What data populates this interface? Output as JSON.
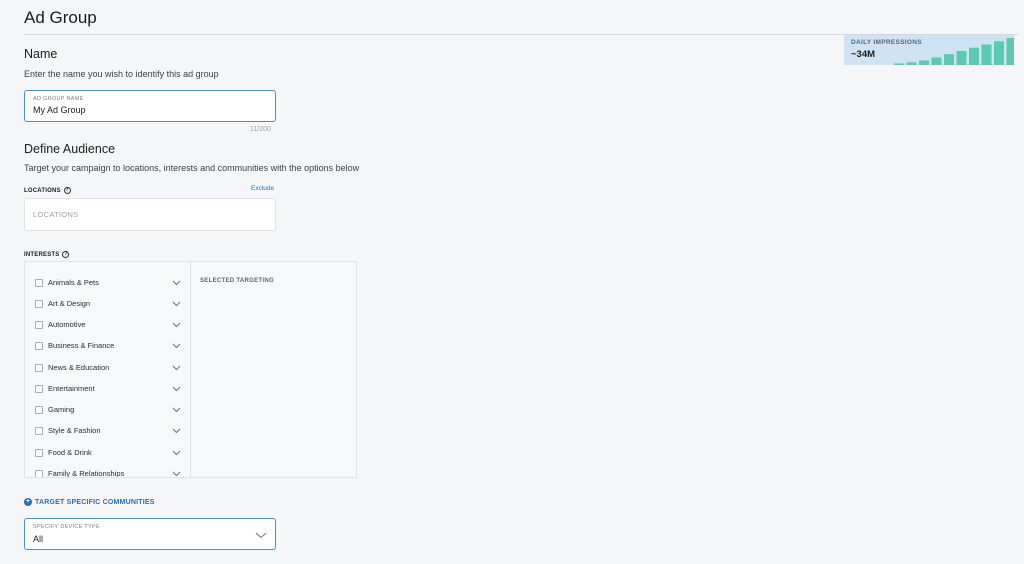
{
  "header": {
    "title": "Ad Group"
  },
  "impressions": {
    "label": "DAILY IMPRESSIONS",
    "value": "~34M",
    "bar_color": "#5cc9b1",
    "bg_color": "#cfe3f3",
    "bar_levels": [
      0.06,
      0.1,
      0.17,
      0.28,
      0.4,
      0.52,
      0.64,
      0.76,
      0.88,
      1.0
    ]
  },
  "name_section": {
    "title": "Name",
    "description": "Enter the name you wish to identify this ad group",
    "input_label": "AD GROUP NAME",
    "input_value": "My Ad Group",
    "char_count": "11/200"
  },
  "audience_section": {
    "title": "Define Audience",
    "description": "Target your campaign to locations, interests and communities with the options below",
    "locations_label": "LOCATIONS",
    "exclude_label": "Exclude",
    "locations_placeholder": "LOCATIONS",
    "interests_label": "INTERESTS",
    "selected_targeting_label": "SELECTED TARGETING",
    "interests": [
      "Animals & Pets",
      "Art & Design",
      "Automotive",
      "Business & Finance",
      "News & Education",
      "Entertainment",
      "Gaming",
      "Style & Fashion",
      "Food & Drink",
      "Family & Relationships"
    ],
    "communities_link": "TARGET SPECIFIC COMMUNITIES",
    "device_label": "SPECIFY DEVICE TYPE",
    "device_value": "All"
  },
  "colors": {
    "accent": "#2a6fb5",
    "input_border_focus": "#4a90c8"
  }
}
